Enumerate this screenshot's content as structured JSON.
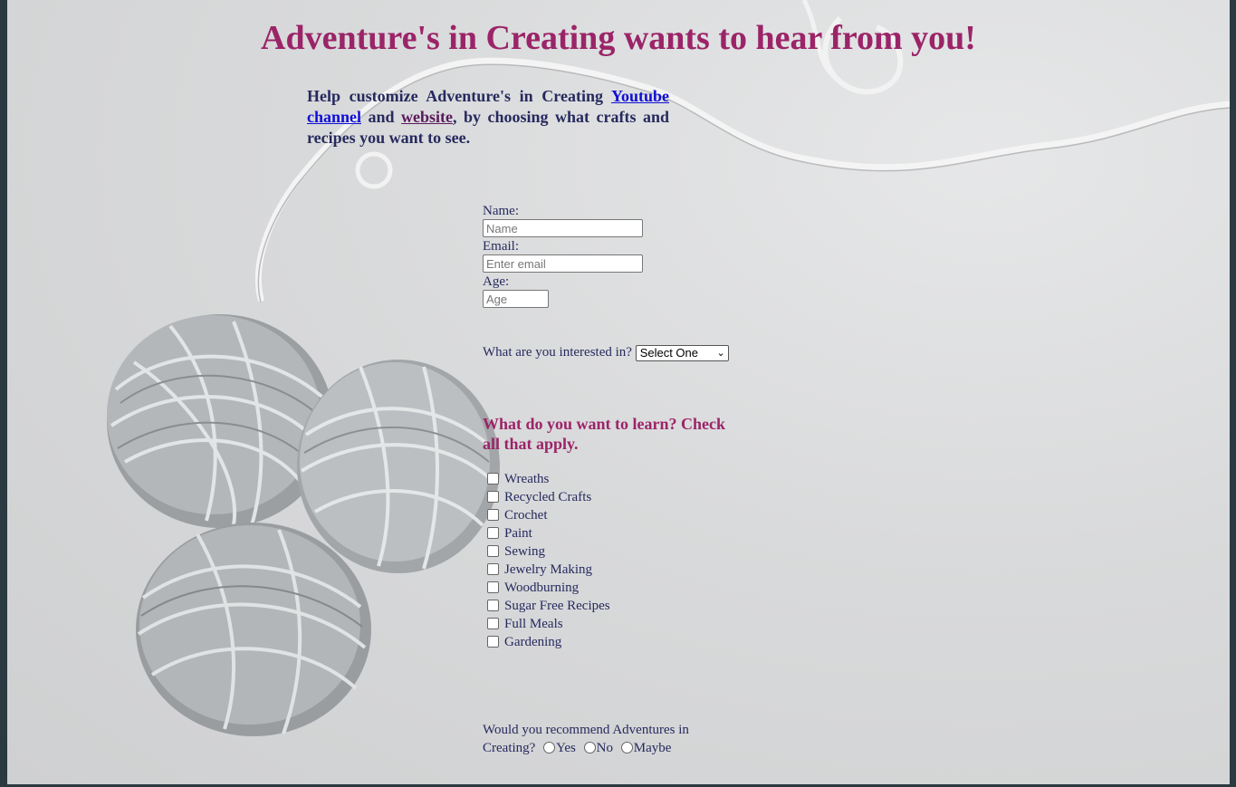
{
  "header": {
    "title": "Adventure's in Creating wants to hear from you!"
  },
  "intro": {
    "text_before": "Help customize Adventure's in Creating",
    "youtube_link": "Youtube channel",
    "and_text": "and",
    "website_link": "website",
    "text_after": ", by choosing what crafts and recipes you want to see."
  },
  "form": {
    "name_label": "Name:",
    "name_placeholder": "Name",
    "email_label": "Email:",
    "email_placeholder": "Enter email",
    "age_label": "Age:",
    "age_placeholder": "Age",
    "interest_label": "What are you interested in?",
    "interest_selected": "Select One",
    "learn_heading": "What do you want to learn? Check all that apply.",
    "learn_options": [
      "Wreaths",
      "Recycled Crafts",
      "Crochet",
      "Paint",
      "Sewing",
      "Jewelry Making",
      "Woodburning",
      "Sugar Free Recipes",
      "Full Meals",
      "Gardening"
    ],
    "recommend_question": "Would you recommend Adventures in Creating?",
    "recommend_options": [
      "Yes",
      "No",
      "Maybe"
    ]
  },
  "colors": {
    "title": "#9b2468",
    "text": "#262a5e",
    "link": "#0f0fd6",
    "visited_link": "#5a1a5c"
  }
}
